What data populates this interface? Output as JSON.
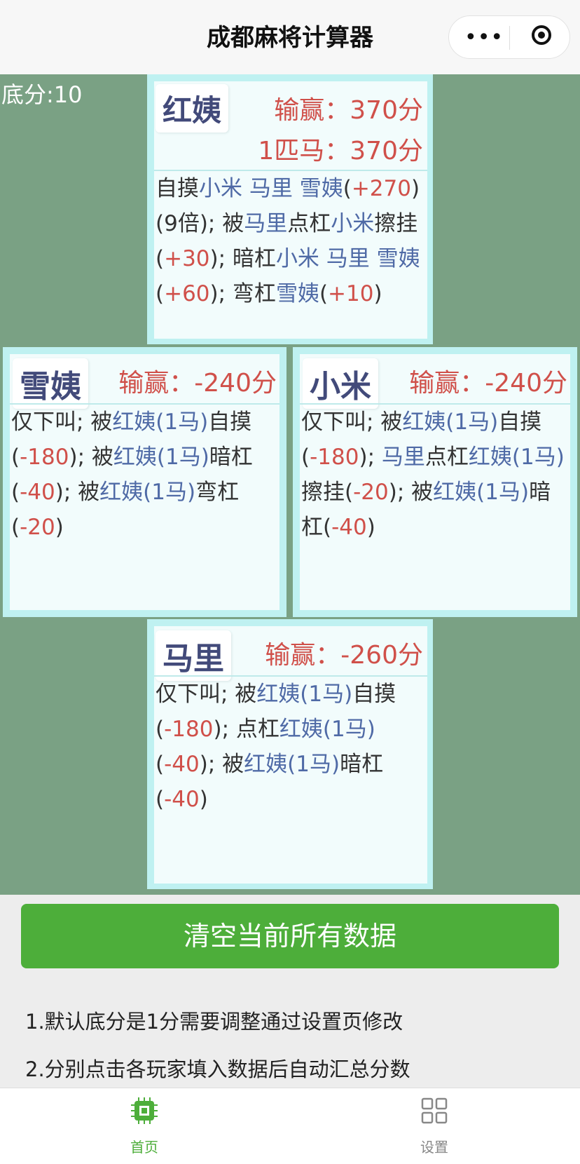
{
  "nav": {
    "title": "成都麻将计算器",
    "more_icon": "•••"
  },
  "base_score": "底分:10",
  "players": {
    "top": {
      "name": "红姨",
      "win_label": "输赢：",
      "win_value": "370分",
      "horse_label": "1匹马：",
      "horse_value": "370分"
    },
    "left": {
      "name": "雪姨",
      "win_label": "输赢：",
      "win_value": "-240分"
    },
    "right": {
      "name": "小米",
      "win_label": "输赢：",
      "win_value": "-240分"
    },
    "bottom": {
      "name": "马里",
      "win_label": "输赢：",
      "win_value": "-260分"
    }
  },
  "clear_button": "清空当前所有数据",
  "tips": [
    "1.默认底分是1分需要调整通过设置页修改",
    "2.分别点击各玩家填入数据后自动汇总分数"
  ],
  "tabbar": {
    "home": {
      "label": "首页",
      "color": "#4dae3a"
    },
    "settings": {
      "label": "设置",
      "color": "#888888"
    }
  },
  "colors": {
    "table": "#7aa184",
    "card_border": "#bff1f1",
    "button": "#4dae3a",
    "negative": "#d0504a",
    "player_ref": "#4f6aa6"
  }
}
